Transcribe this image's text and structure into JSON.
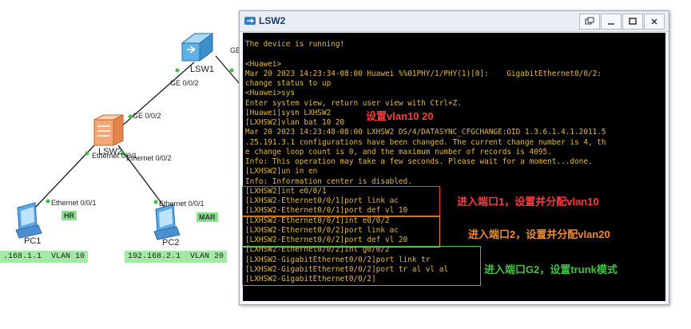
{
  "topology": {
    "devices": [
      {
        "id": "lsw1",
        "name": "LSW1"
      },
      {
        "id": "lsw2",
        "name": "LSW2"
      },
      {
        "id": "pc1",
        "name": "PC1"
      },
      {
        "id": "pc2",
        "name": "PC2"
      }
    ],
    "ports": {
      "lsw1_ge002": "GE 0/0/2",
      "lsw1_partial": "GE",
      "lsw2_ge002": "GE 0/0/2",
      "lsw2_e001": "Ethernet 0/0/1",
      "lsw2_e002": "Ethernet 0/0/2",
      "pc1_e001": "Ethernet 0/0/1",
      "pc2_e001": "Ethernet 0/0/1"
    },
    "tags": {
      "pc1": "HR",
      "pc2": "MAR"
    },
    "ip_labels": {
      "pc1": ".168.1.1  VLAN 10",
      "pc2": "192.168.2.1  VLAN 20"
    },
    "colors": {
      "link": "#1a1a1a",
      "port_dot": "#3fbf3f",
      "ip_bg": "#a6e8a6",
      "tag_bg": "#8ce08c"
    }
  },
  "window": {
    "title": "LSW2",
    "icon": "switch-app-icon",
    "controls": {
      "restore": "restore-icon",
      "minimize": "minimize-icon",
      "maximize": "maximize-icon",
      "close": "close-icon"
    }
  },
  "terminal": {
    "text_color": "#e3ba3e",
    "lines": [
      "The device is running!",
      "",
      "<Huawei>",
      "Mar 20 2023 14:23:34-08:00 Huawei %%01PHY/1/PHY(1)[0]:    GigabitEthernet0/0/2:",
      "change status to up",
      "<Huawei>sys",
      "Enter system view, return user view with Ctrl+Z.",
      "[Huawei]sysn LXHSW2",
      "[LXHSW2]vlan bat 10 20",
      "Mar 20 2023 14:23:48-08:00 LXHSW2 DS/4/DATASYNC_CFGCHANGE:OID 1.3.6.1.4.1.2011.5",
      ".25.191.3.1 configurations have been changed. The current change number is 4, th",
      "e change loop count is 0, and the maximum number of records is 4095.",
      "Info: This operation may take a few seconds. Please wait for a moment...done.",
      "[LXHSW2]un in en",
      "Info: Information center is disabled.",
      "[LXHSW2]int e0/0/1",
      "[LXHSW2-Ethernet0/0/1]port link ac",
      "[LXHSW2-Ethernet0/0/1]port def vl 10",
      "[LXHSW2-Ethernet0/0/1]int e0/0/2",
      "[LXHSW2-Ethernet0/0/2]port link ac",
      "[LXHSW2-Ethernet0/0/2]port def vl 20",
      "[LXHSW2-Ethernet0/0/2]int g0/0/2",
      "[LXHSW2-GigabitEthernet0/0/2]port link tr",
      "[LXHSW2-GigabitEthernet0/0/2]port tr al vl al",
      "[LXHSW2-GigabitEthernet0/0/2]"
    ]
  },
  "annotations": [
    {
      "text": "设置vlan10 20",
      "color": "#ff3b3b"
    },
    {
      "text": "进入端口1，设置并分配vlan10",
      "color": "#ff3b3b"
    },
    {
      "text": "进入端口2，设置并分配vlan20",
      "color": "#f08a2c"
    },
    {
      "text": "进入端口G2，设置trunk模式",
      "color": "#3ec43e"
    }
  ]
}
